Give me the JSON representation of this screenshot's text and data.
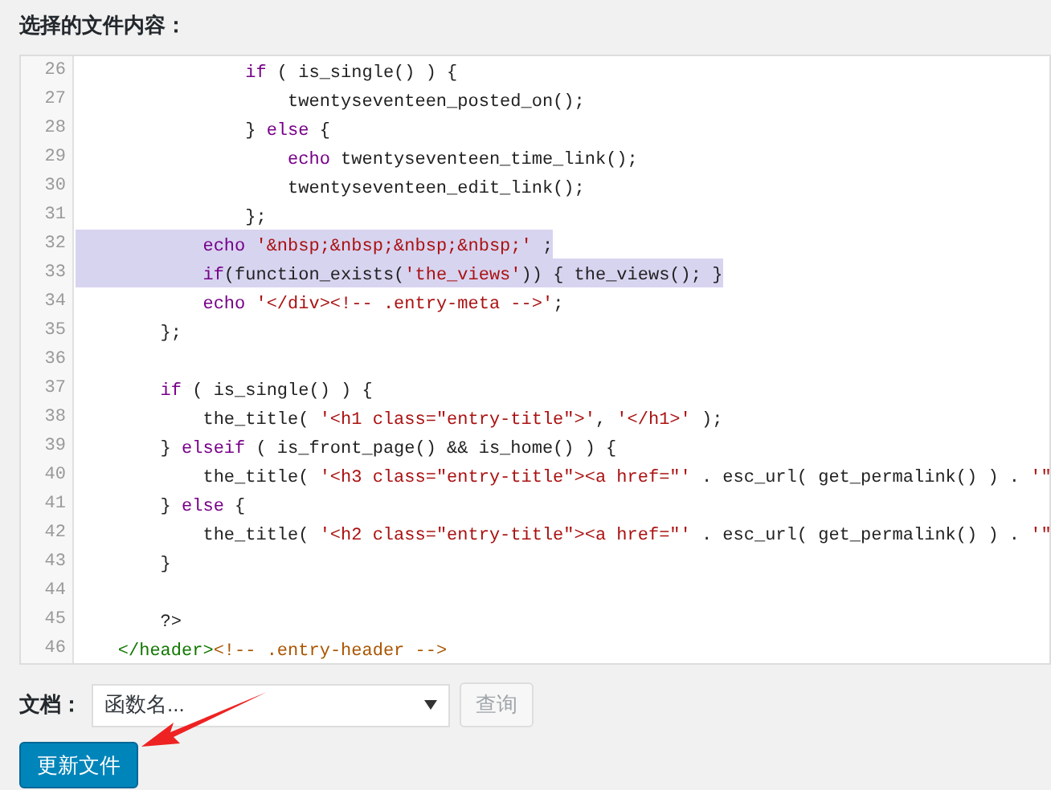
{
  "heading": "选择的文件内容：",
  "editor": {
    "lines": [
      {
        "number": "26",
        "selected": false,
        "segments": [
          {
            "kind": "keyword",
            "text": "                if"
          },
          {
            "kind": "plain",
            "text": " ( is_single() ) {"
          }
        ]
      },
      {
        "number": "27",
        "selected": false,
        "segments": [
          {
            "kind": "plain",
            "text": "                    twentyseventeen_posted_on();"
          }
        ]
      },
      {
        "number": "28",
        "selected": false,
        "segments": [
          {
            "kind": "plain",
            "text": "                } "
          },
          {
            "kind": "keyword",
            "text": "else"
          },
          {
            "kind": "plain",
            "text": " {"
          }
        ]
      },
      {
        "number": "29",
        "selected": false,
        "segments": [
          {
            "kind": "keyword",
            "text": "                    echo"
          },
          {
            "kind": "plain",
            "text": " twentyseventeen_time_link();"
          }
        ]
      },
      {
        "number": "30",
        "selected": false,
        "segments": [
          {
            "kind": "plain",
            "text": "                    twentyseventeen_edit_link();"
          }
        ]
      },
      {
        "number": "31",
        "selected": false,
        "segments": [
          {
            "kind": "plain",
            "text": "                };"
          }
        ]
      },
      {
        "number": "32",
        "selected": true,
        "segments": [
          {
            "kind": "keyword",
            "text": "            echo"
          },
          {
            "kind": "string",
            "text": " '&nbsp;&nbsp;&nbsp;&nbsp;'"
          },
          {
            "kind": "plain",
            "text": " ;"
          }
        ]
      },
      {
        "number": "33",
        "selected": true,
        "segments": [
          {
            "kind": "keyword",
            "text": "            if"
          },
          {
            "kind": "plain",
            "text": "(function_exists("
          },
          {
            "kind": "string",
            "text": "'the_views'"
          },
          {
            "kind": "plain",
            "text": ")) { the_views(); }"
          }
        ]
      },
      {
        "number": "34",
        "selected": false,
        "segments": [
          {
            "kind": "keyword",
            "text": "            echo"
          },
          {
            "kind": "string",
            "text": " '</div><!-- .entry-meta -->'"
          },
          {
            "kind": "plain",
            "text": ";"
          }
        ]
      },
      {
        "number": "35",
        "selected": false,
        "segments": [
          {
            "kind": "plain",
            "text": "        };"
          }
        ]
      },
      {
        "number": "36",
        "selected": false
      },
      {
        "number": "37",
        "selected": false,
        "segments": [
          {
            "kind": "keyword",
            "text": "        if"
          },
          {
            "kind": "plain",
            "text": " ( is_single() ) {"
          }
        ]
      },
      {
        "number": "38",
        "selected": false,
        "segments": [
          {
            "kind": "plain",
            "text": "            the_title( "
          },
          {
            "kind": "string",
            "text": "'<h1 class=\"entry-title\">'"
          },
          {
            "kind": "plain",
            "text": ", "
          },
          {
            "kind": "string",
            "text": "'</h1>'"
          },
          {
            "kind": "plain",
            "text": " );"
          }
        ]
      },
      {
        "number": "39",
        "selected": false,
        "segments": [
          {
            "kind": "plain",
            "text": "        } "
          },
          {
            "kind": "keyword",
            "text": "elseif"
          },
          {
            "kind": "plain",
            "text": " ( is_front_page() && is_home() ) {"
          }
        ]
      },
      {
        "number": "40",
        "selected": false,
        "segments": [
          {
            "kind": "plain",
            "text": "            the_title( "
          },
          {
            "kind": "string",
            "text": "'<h3 class=\"entry-title\"><a href=\"'"
          },
          {
            "kind": "plain",
            "text": " . esc_url( get_permalink() ) . "
          },
          {
            "kind": "string",
            "text": "'\""
          }
        ]
      },
      {
        "number": "41",
        "selected": false,
        "segments": [
          {
            "kind": "plain",
            "text": "        } "
          },
          {
            "kind": "keyword",
            "text": "else"
          },
          {
            "kind": "plain",
            "text": " {"
          }
        ]
      },
      {
        "number": "42",
        "selected": false,
        "segments": [
          {
            "kind": "plain",
            "text": "            the_title( "
          },
          {
            "kind": "string",
            "text": "'<h2 class=\"entry-title\"><a href=\"'"
          },
          {
            "kind": "plain",
            "text": " . esc_url( get_permalink() ) . "
          },
          {
            "kind": "string",
            "text": "'\""
          }
        ]
      },
      {
        "number": "43",
        "selected": false,
        "segments": [
          {
            "kind": "plain",
            "text": "        }"
          }
        ]
      },
      {
        "number": "44",
        "selected": false
      },
      {
        "number": "45",
        "selected": false,
        "segments": [
          {
            "kind": "plain",
            "text": "        ?>"
          }
        ]
      },
      {
        "number": "46",
        "selected": false,
        "segments": [
          {
            "kind": "tag",
            "text": "    </header>"
          },
          {
            "kind": "comment",
            "text": "<!-- .entry-header -->"
          }
        ]
      }
    ]
  },
  "docs": {
    "label": "文档：",
    "select": {
      "placeholder": "函数名..."
    },
    "lookup_button": {
      "label": "查询",
      "disabled": true
    }
  },
  "update_button": {
    "label": "更新文件"
  }
}
